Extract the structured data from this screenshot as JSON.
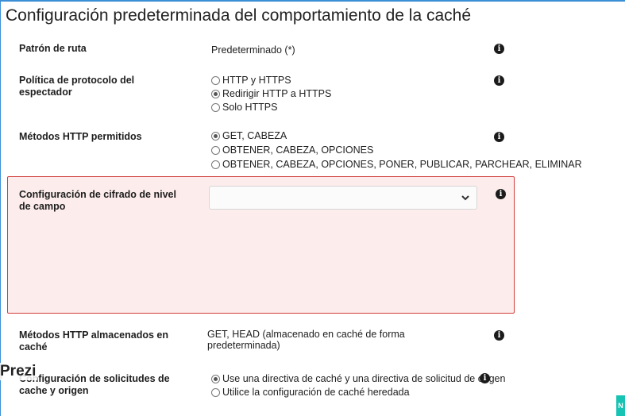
{
  "title": "Configuración predeterminada del comportamiento de la caché",
  "rows": {
    "path_pattern": {
      "label": "Patrón de ruta",
      "value": "Predeterminado (*)"
    },
    "viewer_protocol": {
      "label": "Política de protocolo del espectador",
      "options": [
        "HTTP y HTTPS",
        "Redirigir HTTP a HTTPS",
        "Solo HTTPS"
      ],
      "selected": "Redirigir HTTP a HTTPS"
    },
    "allowed_methods": {
      "label": "Métodos HTTP permitidos",
      "options": [
        "GET, CABEZA",
        "OBTENER, CABEZA, OPCIONES",
        "OBTENER, CABEZA, OPCIONES, PONER, PUBLICAR, PARCHEAR, ELIMINAR"
      ],
      "selected": "GET, CABEZA"
    },
    "field_encryption": {
      "label": "Configuración de cifrado de nivel de campo",
      "select_value": ""
    },
    "cached_methods": {
      "label": "Métodos HTTP almacenados en caché",
      "value": "GET, HEAD (almacenado en caché de forma predeterminada)"
    },
    "cache_origin_requests": {
      "label": "Configuración de solicitudes de cache y origen",
      "options": [
        "Use una directiva de caché y una directiva de solicitud de origen",
        "Utilice la configuración de caché heredada"
      ],
      "selected": "Use una directiva de caché y una directiva de solicitud de origen"
    }
  },
  "overlay": {
    "prezi": "Prezi",
    "corner_badge": "N"
  },
  "icons": {
    "info": "info-icon",
    "chevron": "chevron-down-icon"
  },
  "colors": {
    "error_border": "#d13b3b",
    "error_bg": "#fdecec",
    "frame": "#3b8fd6"
  }
}
